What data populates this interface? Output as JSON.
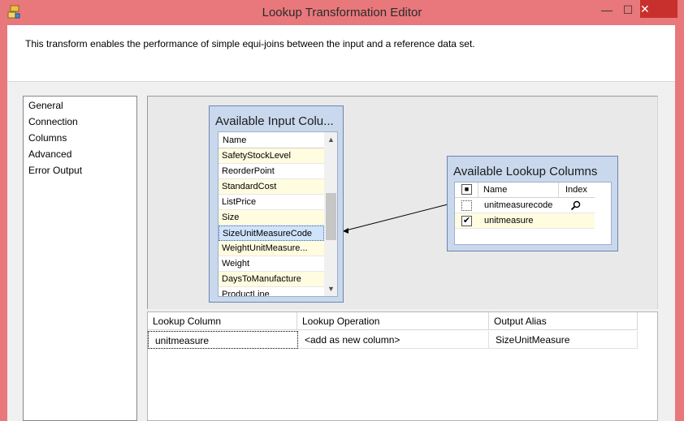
{
  "window": {
    "title": "Lookup Transformation Editor",
    "minimize_glyph": "—",
    "maximize_glyph": "☐",
    "close_glyph": "✕"
  },
  "description": "This transform enables the performance of simple equi-joins between the input and a reference data set.",
  "nav": {
    "items": [
      {
        "label": "General"
      },
      {
        "label": "Connection"
      },
      {
        "label": "Columns",
        "selected": true
      },
      {
        "label": "Advanced"
      },
      {
        "label": "Error Output"
      }
    ]
  },
  "input_columns": {
    "title": "Available Input Colu...",
    "header": "Name",
    "rows": [
      {
        "name": "SafetyStockLevel"
      },
      {
        "name": "ReorderPoint"
      },
      {
        "name": "StandardCost"
      },
      {
        "name": "ListPrice"
      },
      {
        "name": "Size"
      },
      {
        "name": "SizeUnitMeasureCode",
        "selected": true
      },
      {
        "name": "WeightUnitMeasure..."
      },
      {
        "name": "Weight"
      },
      {
        "name": "DaysToManufacture"
      },
      {
        "name": "ProductLine"
      }
    ]
  },
  "lookup_columns": {
    "title": "Available Lookup Columns",
    "header_name": "Name",
    "header_index": "Index",
    "header_check_glyph": "■",
    "rows": [
      {
        "name": "unitmeasurecode",
        "checked": false,
        "check_glyph": "",
        "index_icon": "search-icon"
      },
      {
        "name": "unitmeasure",
        "checked": true,
        "check_glyph": "✔",
        "index_icon": ""
      }
    ]
  },
  "grid": {
    "headers": [
      "Lookup Column",
      "Lookup Operation",
      "Output Alias"
    ],
    "rows": [
      {
        "lookup_column": "unitmeasure",
        "lookup_operation": "<add as new column>",
        "output_alias": "SizeUnitMeasure"
      }
    ]
  },
  "scroll_glyphs": {
    "up": "▲",
    "down": "▼"
  },
  "colors": {
    "titlebar": "#e8787b",
    "close_button": "#c7302c",
    "box_background": "#c9d8ec",
    "row_highlight": "#fffce0",
    "selected_row": "#cfe3fb"
  }
}
